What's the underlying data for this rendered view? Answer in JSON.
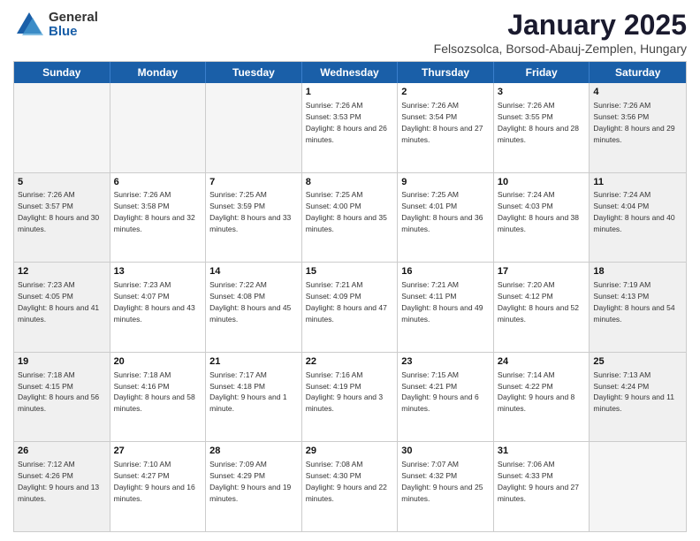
{
  "logo": {
    "general": "General",
    "blue": "Blue"
  },
  "title": {
    "month": "January 2025",
    "location": "Felsozsolca, Borsod-Abauj-Zemplen, Hungary"
  },
  "days": [
    "Sunday",
    "Monday",
    "Tuesday",
    "Wednesday",
    "Thursday",
    "Friday",
    "Saturday"
  ],
  "weeks": [
    [
      {
        "day": "",
        "text": "",
        "empty": true
      },
      {
        "day": "",
        "text": "",
        "empty": true
      },
      {
        "day": "",
        "text": "",
        "empty": true
      },
      {
        "day": "1",
        "text": "Sunrise: 7:26 AM\nSunset: 3:53 PM\nDaylight: 8 hours and 26 minutes."
      },
      {
        "day": "2",
        "text": "Sunrise: 7:26 AM\nSunset: 3:54 PM\nDaylight: 8 hours and 27 minutes."
      },
      {
        "day": "3",
        "text": "Sunrise: 7:26 AM\nSunset: 3:55 PM\nDaylight: 8 hours and 28 minutes."
      },
      {
        "day": "4",
        "text": "Sunrise: 7:26 AM\nSunset: 3:56 PM\nDaylight: 8 hours and 29 minutes.",
        "shaded": true
      }
    ],
    [
      {
        "day": "5",
        "text": "Sunrise: 7:26 AM\nSunset: 3:57 PM\nDaylight: 8 hours and 30 minutes.",
        "shaded": true
      },
      {
        "day": "6",
        "text": "Sunrise: 7:26 AM\nSunset: 3:58 PM\nDaylight: 8 hours and 32 minutes."
      },
      {
        "day": "7",
        "text": "Sunrise: 7:25 AM\nSunset: 3:59 PM\nDaylight: 8 hours and 33 minutes."
      },
      {
        "day": "8",
        "text": "Sunrise: 7:25 AM\nSunset: 4:00 PM\nDaylight: 8 hours and 35 minutes."
      },
      {
        "day": "9",
        "text": "Sunrise: 7:25 AM\nSunset: 4:01 PM\nDaylight: 8 hours and 36 minutes."
      },
      {
        "day": "10",
        "text": "Sunrise: 7:24 AM\nSunset: 4:03 PM\nDaylight: 8 hours and 38 minutes."
      },
      {
        "day": "11",
        "text": "Sunrise: 7:24 AM\nSunset: 4:04 PM\nDaylight: 8 hours and 40 minutes.",
        "shaded": true
      }
    ],
    [
      {
        "day": "12",
        "text": "Sunrise: 7:23 AM\nSunset: 4:05 PM\nDaylight: 8 hours and 41 minutes.",
        "shaded": true
      },
      {
        "day": "13",
        "text": "Sunrise: 7:23 AM\nSunset: 4:07 PM\nDaylight: 8 hours and 43 minutes."
      },
      {
        "day": "14",
        "text": "Sunrise: 7:22 AM\nSunset: 4:08 PM\nDaylight: 8 hours and 45 minutes."
      },
      {
        "day": "15",
        "text": "Sunrise: 7:21 AM\nSunset: 4:09 PM\nDaylight: 8 hours and 47 minutes."
      },
      {
        "day": "16",
        "text": "Sunrise: 7:21 AM\nSunset: 4:11 PM\nDaylight: 8 hours and 49 minutes."
      },
      {
        "day": "17",
        "text": "Sunrise: 7:20 AM\nSunset: 4:12 PM\nDaylight: 8 hours and 52 minutes."
      },
      {
        "day": "18",
        "text": "Sunrise: 7:19 AM\nSunset: 4:13 PM\nDaylight: 8 hours and 54 minutes.",
        "shaded": true
      }
    ],
    [
      {
        "day": "19",
        "text": "Sunrise: 7:18 AM\nSunset: 4:15 PM\nDaylight: 8 hours and 56 minutes.",
        "shaded": true
      },
      {
        "day": "20",
        "text": "Sunrise: 7:18 AM\nSunset: 4:16 PM\nDaylight: 8 hours and 58 minutes."
      },
      {
        "day": "21",
        "text": "Sunrise: 7:17 AM\nSunset: 4:18 PM\nDaylight: 9 hours and 1 minute."
      },
      {
        "day": "22",
        "text": "Sunrise: 7:16 AM\nSunset: 4:19 PM\nDaylight: 9 hours and 3 minutes."
      },
      {
        "day": "23",
        "text": "Sunrise: 7:15 AM\nSunset: 4:21 PM\nDaylight: 9 hours and 6 minutes."
      },
      {
        "day": "24",
        "text": "Sunrise: 7:14 AM\nSunset: 4:22 PM\nDaylight: 9 hours and 8 minutes."
      },
      {
        "day": "25",
        "text": "Sunrise: 7:13 AM\nSunset: 4:24 PM\nDaylight: 9 hours and 11 minutes.",
        "shaded": true
      }
    ],
    [
      {
        "day": "26",
        "text": "Sunrise: 7:12 AM\nSunset: 4:26 PM\nDaylight: 9 hours and 13 minutes.",
        "shaded": true
      },
      {
        "day": "27",
        "text": "Sunrise: 7:10 AM\nSunset: 4:27 PM\nDaylight: 9 hours and 16 minutes."
      },
      {
        "day": "28",
        "text": "Sunrise: 7:09 AM\nSunset: 4:29 PM\nDaylight: 9 hours and 19 minutes."
      },
      {
        "day": "29",
        "text": "Sunrise: 7:08 AM\nSunset: 4:30 PM\nDaylight: 9 hours and 22 minutes."
      },
      {
        "day": "30",
        "text": "Sunrise: 7:07 AM\nSunset: 4:32 PM\nDaylight: 9 hours and 25 minutes."
      },
      {
        "day": "31",
        "text": "Sunrise: 7:06 AM\nSunset: 4:33 PM\nDaylight: 9 hours and 27 minutes."
      },
      {
        "day": "",
        "text": "",
        "empty": true
      }
    ]
  ]
}
